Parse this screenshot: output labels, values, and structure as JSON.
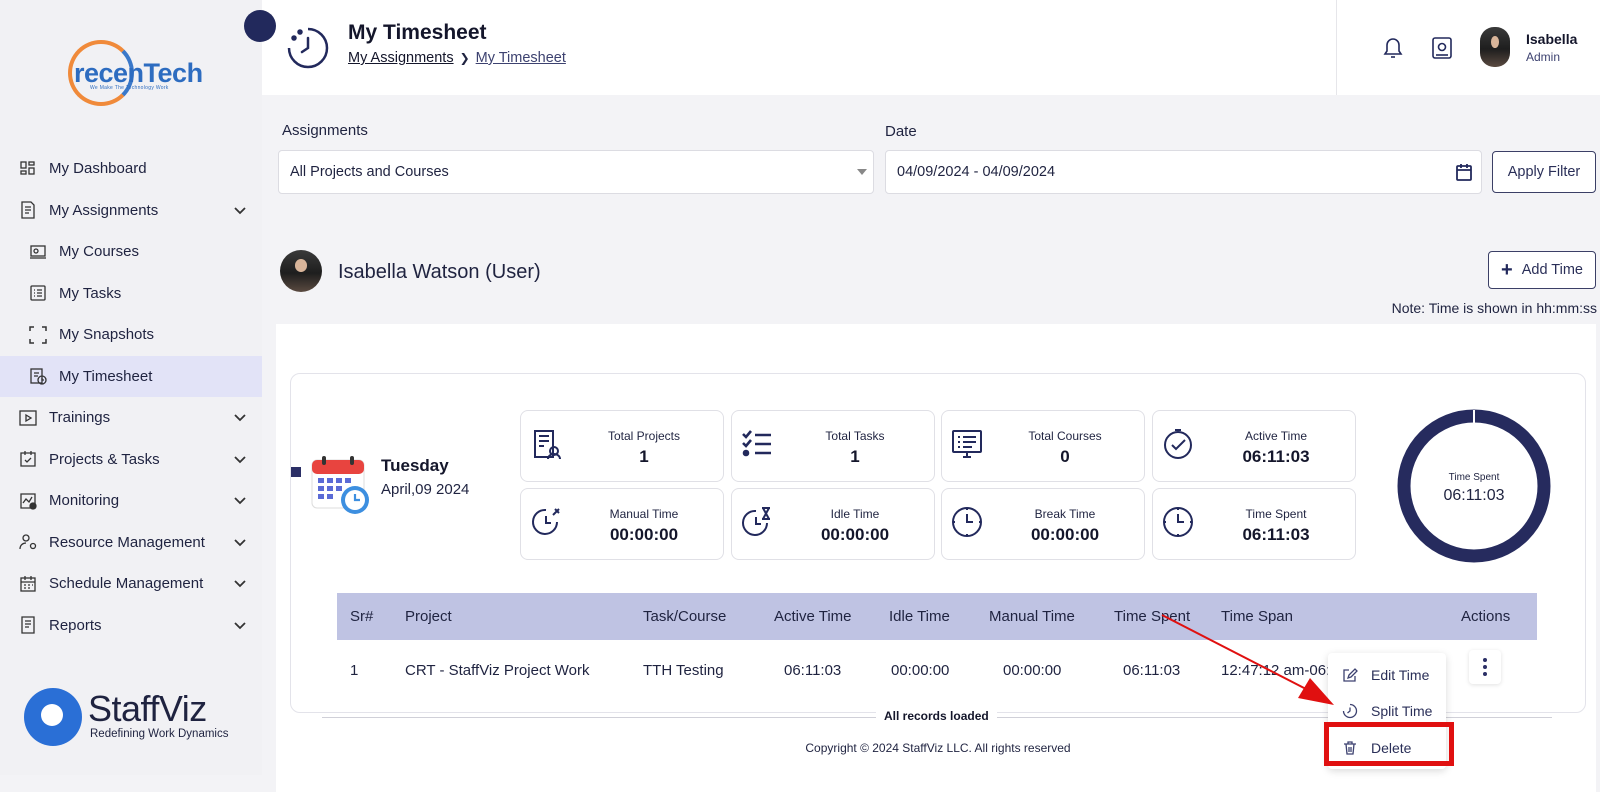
{
  "brand": {
    "logo_name": "recenTech",
    "logo_tagline": "We Make The Technology Work",
    "footer_logo_name": "StaffViz",
    "footer_logo_tagline": "Redefining Work Dynamics"
  },
  "sidebar": {
    "items": [
      {
        "label": "My Dashboard",
        "icon": "dashboard-icon"
      },
      {
        "label": "My Assignments",
        "icon": "assignments-icon"
      },
      {
        "label": "My Courses",
        "icon": "courses-icon"
      },
      {
        "label": "My Tasks",
        "icon": "tasks-icon"
      },
      {
        "label": "My Snapshots",
        "icon": "snapshots-icon"
      },
      {
        "label": "My Timesheet",
        "icon": "timesheet-icon"
      },
      {
        "label": "Trainings",
        "icon": "trainings-icon"
      },
      {
        "label": "Projects & Tasks",
        "icon": "projects-icon"
      },
      {
        "label": "Monitoring",
        "icon": "monitoring-icon"
      },
      {
        "label": "Resource Management",
        "icon": "resource-icon"
      },
      {
        "label": "Schedule Management",
        "icon": "schedule-icon"
      },
      {
        "label": "Reports",
        "icon": "reports-icon"
      }
    ]
  },
  "header": {
    "title": "My Timesheet",
    "breadcrumb": [
      "My Assignments",
      "My Timesheet"
    ],
    "user_name": "Isabella",
    "user_role": "Admin"
  },
  "filters": {
    "assignments_label": "Assignments",
    "assignments_value": "All Projects and Courses",
    "date_label": "Date",
    "date_value": "04/09/2024 - 04/09/2024",
    "apply_label": "Apply Filter"
  },
  "user_section": {
    "name": "Isabella Watson (User)",
    "add_time_label": "Add Time",
    "note": "Note: Time is shown in hh:mm:ss"
  },
  "day": {
    "name": "Tuesday",
    "date": "April,09 2024"
  },
  "stats": [
    {
      "title": "Total Projects",
      "value": "1",
      "icon": "projects-doc-icon"
    },
    {
      "title": "Total Tasks",
      "value": "1",
      "icon": "checklist-icon"
    },
    {
      "title": "Total Courses",
      "value": "0",
      "icon": "monitor-list-icon"
    },
    {
      "title": "Active Time",
      "value": "06:11:03",
      "icon": "clock-check-icon"
    },
    {
      "title": "Manual Time",
      "value": "00:00:00",
      "icon": "clock-pen-icon"
    },
    {
      "title": "Idle Time",
      "value": "00:00:00",
      "icon": "clock-hourglass-icon"
    },
    {
      "title": "Break Time",
      "value": "00:00:00",
      "icon": "clock-icon"
    },
    {
      "title": "Time Spent",
      "value": "06:11:03",
      "icon": "clock-icon"
    }
  ],
  "donut": {
    "label": "Time Spent",
    "value": "06:11:03",
    "fill_fraction": 1.0,
    "color": "#262b5e"
  },
  "table": {
    "headers": [
      "Sr#",
      "Project",
      "Task/Course",
      "Active Time",
      "Idle Time",
      "Manual Time",
      "Time Spent",
      "Time Span",
      "Actions"
    ],
    "rows": [
      [
        "1",
        "CRT - StaffViz Project Work",
        "TTH Testing",
        "06:11:03",
        "00:00:00",
        "00:00:00",
        "06:11:03",
        "12:47:12 am-06:"
      ]
    ],
    "footer": "All records loaded"
  },
  "actions_menu": [
    "Edit Time",
    "Split Time",
    "Delete"
  ],
  "copyright": "Copyright © 2024 StaffViz LLC. All rights reserved",
  "colors": {
    "accent": "#262b5e",
    "table_header": "#bfc3e3",
    "active_nav": "#e2e3f7",
    "highlight": "#e01010"
  }
}
